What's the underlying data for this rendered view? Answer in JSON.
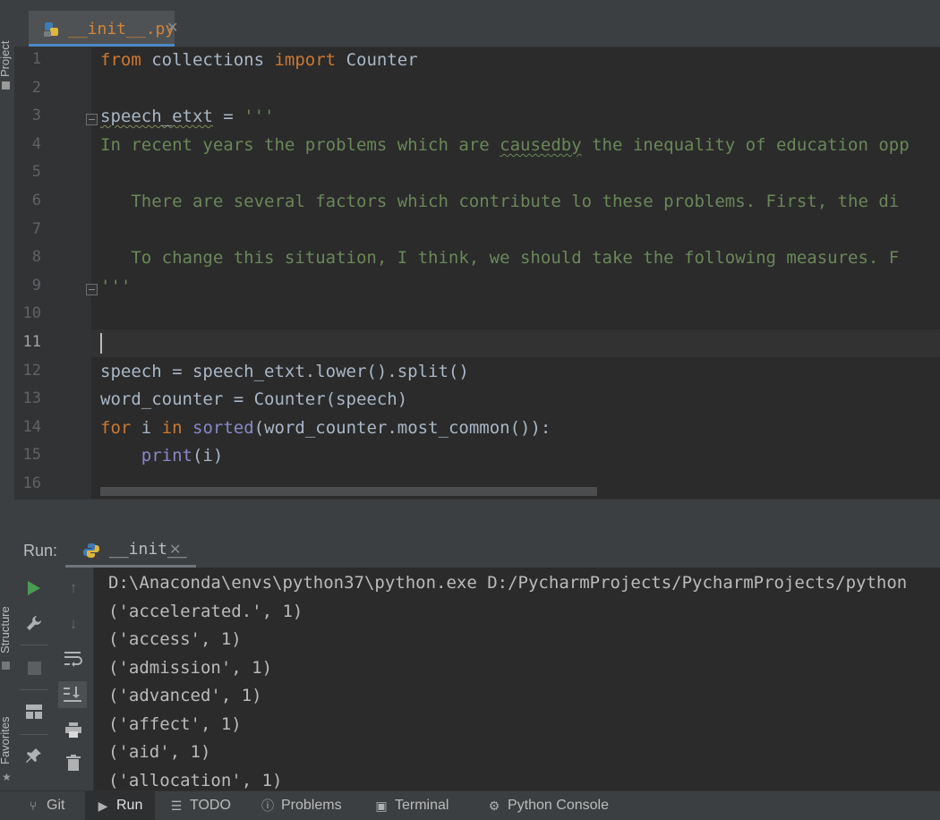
{
  "editor_tab": {
    "filename": "__init__.py",
    "close_glyph": "✕"
  },
  "left_stripe": {
    "project_label": "Project",
    "structure_label": "Structure",
    "favorites_label": "Favorites"
  },
  "editor": {
    "line_numbers": [
      "1",
      "2",
      "3",
      "4",
      "5",
      "6",
      "7",
      "8",
      "9",
      "10",
      "11",
      "12",
      "13",
      "14",
      "15",
      "16"
    ],
    "current_line": "11",
    "lines": [
      [
        {
          "t": "from",
          "c": "kw"
        },
        {
          "t": " collections ",
          "c": ""
        },
        {
          "t": "import",
          "c": "kw"
        },
        {
          "t": " Counter",
          "c": ""
        }
      ],
      [],
      [
        {
          "t": "speech_etxt",
          "c": "squiggle-plain"
        },
        {
          "t": " = ",
          "c": ""
        },
        {
          "t": "'''",
          "c": "str"
        }
      ],
      [
        {
          "t": "In recent years the problems which are ",
          "c": "str"
        },
        {
          "t": "causedby",
          "c": "str squiggle"
        },
        {
          "t": " the inequality of education opp",
          "c": "str"
        }
      ],
      [],
      [
        {
          "t": "   There are several factors which contribute lo these problems. First, the di",
          "c": "str"
        }
      ],
      [],
      [
        {
          "t": "   To change this situation, I think, we should take the following measures. F",
          "c": "str"
        }
      ],
      [
        {
          "t": "'''",
          "c": "str"
        }
      ],
      [],
      [],
      [
        {
          "t": "speech = speech_etxt.lower().split()",
          "c": ""
        }
      ],
      [
        {
          "t": "word_counter = Counter(speech)",
          "c": ""
        }
      ],
      [
        {
          "t": "for",
          "c": "kw"
        },
        {
          "t": " i ",
          "c": ""
        },
        {
          "t": "in",
          "c": "kw"
        },
        {
          "t": " ",
          "c": ""
        },
        {
          "t": "sorted",
          "c": "bi"
        },
        {
          "t": "(word_counter.most_common()):",
          "c": ""
        }
      ],
      [
        {
          "t": "    ",
          "c": ""
        },
        {
          "t": "print",
          "c": "bi"
        },
        {
          "t": "(i)",
          "c": ""
        }
      ],
      []
    ]
  },
  "run_panel": {
    "label": "Run:",
    "tab_label": "__init__",
    "close_glyph": "✕",
    "output": [
      "D:\\Anaconda\\envs\\python37\\python.exe D:/PycharmProjects/PycharmProjects/python",
      "('accelerated.', 1)",
      "('access', 1)",
      "('admission', 1)",
      "('advanced', 1)",
      "('affect', 1)",
      "('aid', 1)",
      "('allocation', 1)"
    ]
  },
  "bottom_bar": {
    "git": "Git",
    "run": "Run",
    "todo": "TODO",
    "problems": "Problems",
    "terminal": "Terminal",
    "python_console": "Python Console"
  },
  "colors": {
    "keyword": "#cc7832",
    "string": "#6a8759",
    "builtin": "#8888c6",
    "filename": "#d2843a",
    "accent": "#4a88c7",
    "run_green": "#499c54"
  }
}
